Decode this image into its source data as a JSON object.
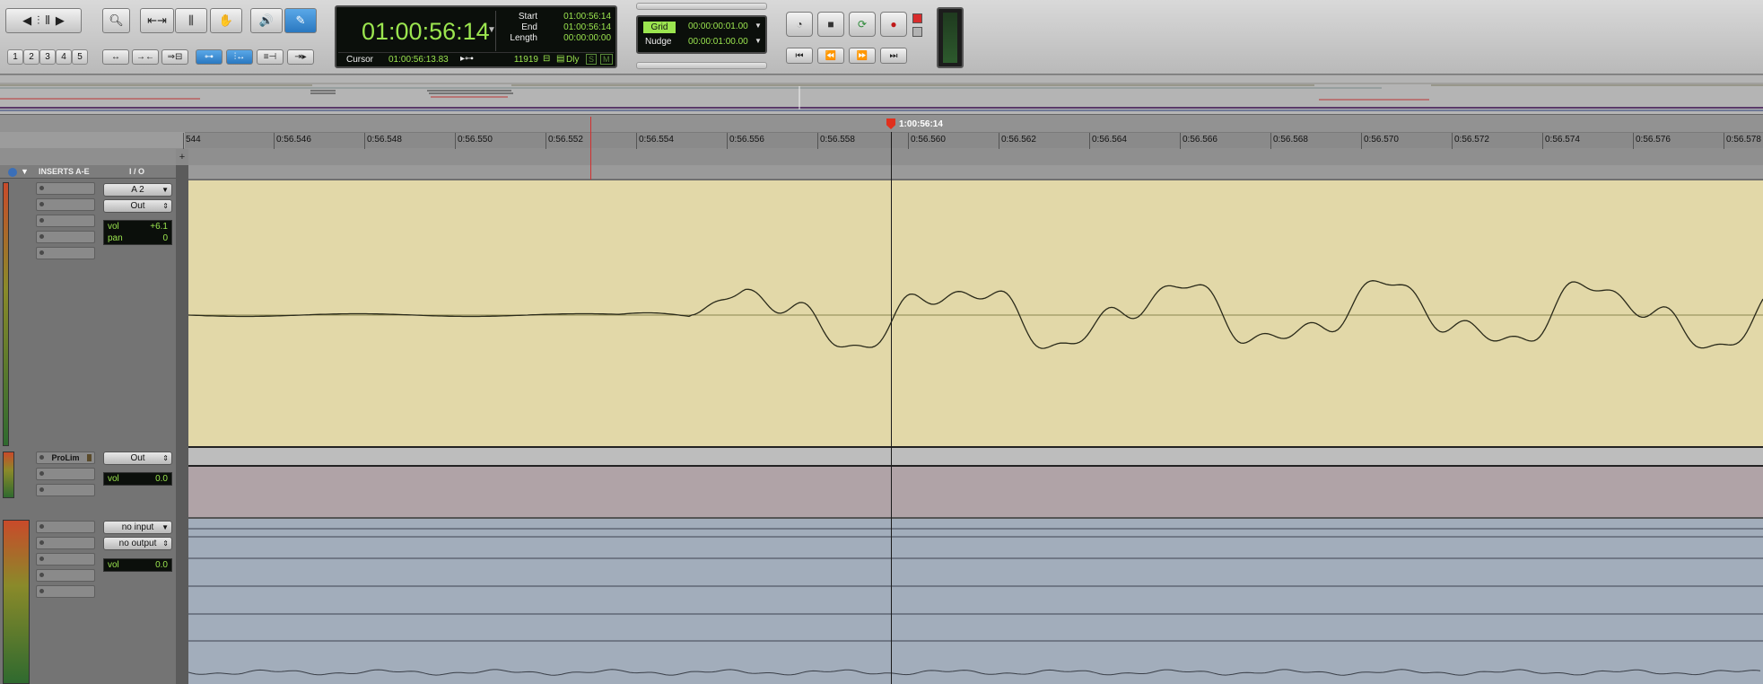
{
  "counter": {
    "main_time": "01:00:56:14",
    "labels": {
      "start": "Start",
      "end": "End",
      "length": "Length"
    },
    "start": "01:00:56:14",
    "end": "01:00:56:14",
    "length": "00:00:00:00",
    "cursor_label": "Cursor",
    "cursor_value": "01:00:56:13.83",
    "sample_value": "11919",
    "dly_label": "Dly"
  },
  "grid": {
    "grid_label": "Grid",
    "grid_value": "00:00:00:01.00",
    "nudge_label": "Nudge",
    "nudge_value": "00:00:01:00.00"
  },
  "toolbar": {
    "numbers": [
      "1",
      "2",
      "3",
      "4",
      "5"
    ]
  },
  "ruler": {
    "playhead_time": "1:00:56:14",
    "ticks": [
      "544",
      "0:56.546",
      "0:56.548",
      "0:56.550",
      "0:56.552",
      "0:56.554",
      "0:56.556",
      "0:56.558",
      "0:56.560",
      "0:56.562",
      "0:56.564",
      "0:56.566",
      "0:56.568",
      "0:56.570",
      "0:56.572",
      "0:56.574",
      "0:56.576",
      "0:56.578"
    ]
  },
  "columns": {
    "inserts": "INSERTS A-E",
    "io": "I / O"
  },
  "tracks": [
    {
      "input": "A 2",
      "output": "Out",
      "vol_label": "vol",
      "vol": "+6.1",
      "pan_label": "pan",
      "pan": "0"
    },
    {
      "insert": "ProLim",
      "output": "Out",
      "vol_label": "vol",
      "vol": "0.0"
    },
    {
      "input": "no input",
      "output": "no output",
      "vol_label": "vol",
      "vol": "0.0"
    }
  ],
  "colors": {
    "track_audio": "#e2d8a8",
    "track_aux": "#b0a3a7",
    "track_master": "#a2adbb",
    "lcd_green": "#9be54f",
    "playhead": "#e0301e"
  }
}
